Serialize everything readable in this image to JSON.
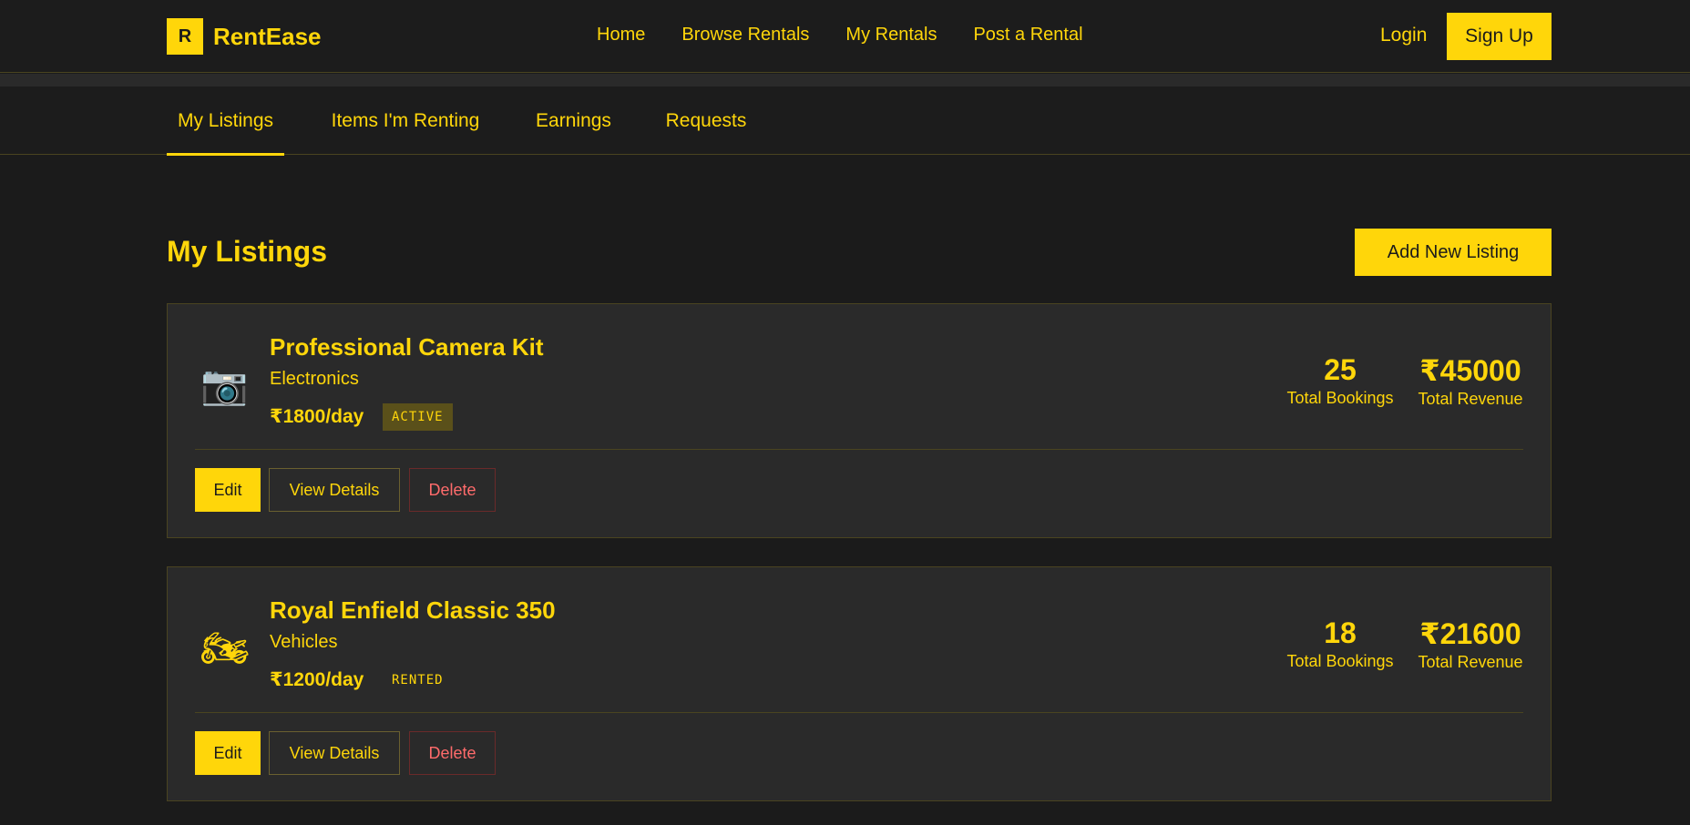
{
  "header": {
    "logo_letter": "R",
    "brand": "RentEase",
    "nav": [
      "Home",
      "Browse Rentals",
      "My Rentals",
      "Post a Rental"
    ],
    "login": "Login",
    "signup": "Sign Up"
  },
  "tabs": [
    {
      "label": "My Listings",
      "active": true
    },
    {
      "label": "Items I'm Renting",
      "active": false
    },
    {
      "label": "Earnings",
      "active": false
    },
    {
      "label": "Requests",
      "active": false
    }
  ],
  "main": {
    "title": "My Listings",
    "add_button": "Add New Listing"
  },
  "listings": [
    {
      "icon": "camera-icon",
      "icon_glyph": "📷",
      "title": "Professional Camera Kit",
      "category": "Electronics",
      "price": "₹1800/day",
      "status": "ACTIVE",
      "bookings": "25",
      "bookings_label": "Total Bookings",
      "revenue": "₹45000",
      "revenue_label": "Total Revenue",
      "edit": "Edit",
      "view": "View Details",
      "delete": "Delete"
    },
    {
      "icon": "motorcycle-icon",
      "icon_glyph": "🏍",
      "title": "Royal Enfield Classic 350",
      "category": "Vehicles",
      "price": "₹1200/day",
      "status": "RENTED",
      "bookings": "18",
      "bookings_label": "Total Bookings",
      "revenue": "₹21600",
      "revenue_label": "Total Revenue",
      "edit": "Edit",
      "view": "View Details",
      "delete": "Delete"
    }
  ],
  "colors": {
    "accent": "#ffd60a",
    "background": "#1b1b1b",
    "card": "#2a2a2a",
    "danger": "#ff6b6b"
  }
}
